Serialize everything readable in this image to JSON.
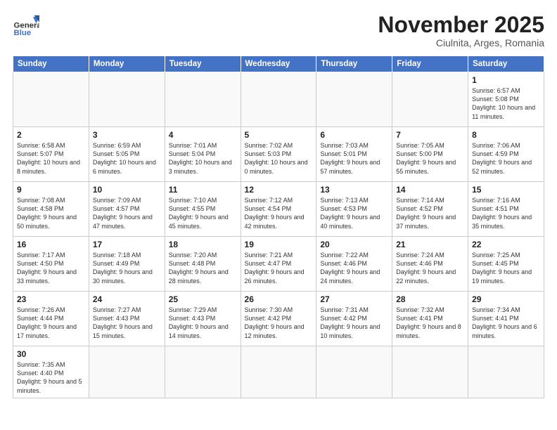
{
  "header": {
    "logo_general": "General",
    "logo_blue": "Blue",
    "month": "November 2025",
    "location": "Ciulnita, Arges, Romania"
  },
  "days_of_week": [
    "Sunday",
    "Monday",
    "Tuesday",
    "Wednesday",
    "Thursday",
    "Friday",
    "Saturday"
  ],
  "weeks": [
    [
      {
        "day": "",
        "info": ""
      },
      {
        "day": "",
        "info": ""
      },
      {
        "day": "",
        "info": ""
      },
      {
        "day": "",
        "info": ""
      },
      {
        "day": "",
        "info": ""
      },
      {
        "day": "",
        "info": ""
      },
      {
        "day": "1",
        "info": "Sunrise: 6:57 AM\nSunset: 5:08 PM\nDaylight: 10 hours and 11 minutes."
      }
    ],
    [
      {
        "day": "2",
        "info": "Sunrise: 6:58 AM\nSunset: 5:07 PM\nDaylight: 10 hours and 8 minutes."
      },
      {
        "day": "3",
        "info": "Sunrise: 6:59 AM\nSunset: 5:05 PM\nDaylight: 10 hours and 6 minutes."
      },
      {
        "day": "4",
        "info": "Sunrise: 7:01 AM\nSunset: 5:04 PM\nDaylight: 10 hours and 3 minutes."
      },
      {
        "day": "5",
        "info": "Sunrise: 7:02 AM\nSunset: 5:03 PM\nDaylight: 10 hours and 0 minutes."
      },
      {
        "day": "6",
        "info": "Sunrise: 7:03 AM\nSunset: 5:01 PM\nDaylight: 9 hours and 57 minutes."
      },
      {
        "day": "7",
        "info": "Sunrise: 7:05 AM\nSunset: 5:00 PM\nDaylight: 9 hours and 55 minutes."
      },
      {
        "day": "8",
        "info": "Sunrise: 7:06 AM\nSunset: 4:59 PM\nDaylight: 9 hours and 52 minutes."
      }
    ],
    [
      {
        "day": "9",
        "info": "Sunrise: 7:08 AM\nSunset: 4:58 PM\nDaylight: 9 hours and 50 minutes."
      },
      {
        "day": "10",
        "info": "Sunrise: 7:09 AM\nSunset: 4:57 PM\nDaylight: 9 hours and 47 minutes."
      },
      {
        "day": "11",
        "info": "Sunrise: 7:10 AM\nSunset: 4:55 PM\nDaylight: 9 hours and 45 minutes."
      },
      {
        "day": "12",
        "info": "Sunrise: 7:12 AM\nSunset: 4:54 PM\nDaylight: 9 hours and 42 minutes."
      },
      {
        "day": "13",
        "info": "Sunrise: 7:13 AM\nSunset: 4:53 PM\nDaylight: 9 hours and 40 minutes."
      },
      {
        "day": "14",
        "info": "Sunrise: 7:14 AM\nSunset: 4:52 PM\nDaylight: 9 hours and 37 minutes."
      },
      {
        "day": "15",
        "info": "Sunrise: 7:16 AM\nSunset: 4:51 PM\nDaylight: 9 hours and 35 minutes."
      }
    ],
    [
      {
        "day": "16",
        "info": "Sunrise: 7:17 AM\nSunset: 4:50 PM\nDaylight: 9 hours and 33 minutes."
      },
      {
        "day": "17",
        "info": "Sunrise: 7:18 AM\nSunset: 4:49 PM\nDaylight: 9 hours and 30 minutes."
      },
      {
        "day": "18",
        "info": "Sunrise: 7:20 AM\nSunset: 4:48 PM\nDaylight: 9 hours and 28 minutes."
      },
      {
        "day": "19",
        "info": "Sunrise: 7:21 AM\nSunset: 4:47 PM\nDaylight: 9 hours and 26 minutes."
      },
      {
        "day": "20",
        "info": "Sunrise: 7:22 AM\nSunset: 4:46 PM\nDaylight: 9 hours and 24 minutes."
      },
      {
        "day": "21",
        "info": "Sunrise: 7:24 AM\nSunset: 4:46 PM\nDaylight: 9 hours and 22 minutes."
      },
      {
        "day": "22",
        "info": "Sunrise: 7:25 AM\nSunset: 4:45 PM\nDaylight: 9 hours and 19 minutes."
      }
    ],
    [
      {
        "day": "23",
        "info": "Sunrise: 7:26 AM\nSunset: 4:44 PM\nDaylight: 9 hours and 17 minutes."
      },
      {
        "day": "24",
        "info": "Sunrise: 7:27 AM\nSunset: 4:43 PM\nDaylight: 9 hours and 15 minutes."
      },
      {
        "day": "25",
        "info": "Sunrise: 7:29 AM\nSunset: 4:43 PM\nDaylight: 9 hours and 14 minutes."
      },
      {
        "day": "26",
        "info": "Sunrise: 7:30 AM\nSunset: 4:42 PM\nDaylight: 9 hours and 12 minutes."
      },
      {
        "day": "27",
        "info": "Sunrise: 7:31 AM\nSunset: 4:42 PM\nDaylight: 9 hours and 10 minutes."
      },
      {
        "day": "28",
        "info": "Sunrise: 7:32 AM\nSunset: 4:41 PM\nDaylight: 9 hours and 8 minutes."
      },
      {
        "day": "29",
        "info": "Sunrise: 7:34 AM\nSunset: 4:41 PM\nDaylight: 9 hours and 6 minutes."
      }
    ],
    [
      {
        "day": "30",
        "info": "Sunrise: 7:35 AM\nSunset: 4:40 PM\nDaylight: 9 hours and 5 minutes."
      },
      {
        "day": "",
        "info": ""
      },
      {
        "day": "",
        "info": ""
      },
      {
        "day": "",
        "info": ""
      },
      {
        "day": "",
        "info": ""
      },
      {
        "day": "",
        "info": ""
      },
      {
        "day": "",
        "info": ""
      }
    ]
  ]
}
